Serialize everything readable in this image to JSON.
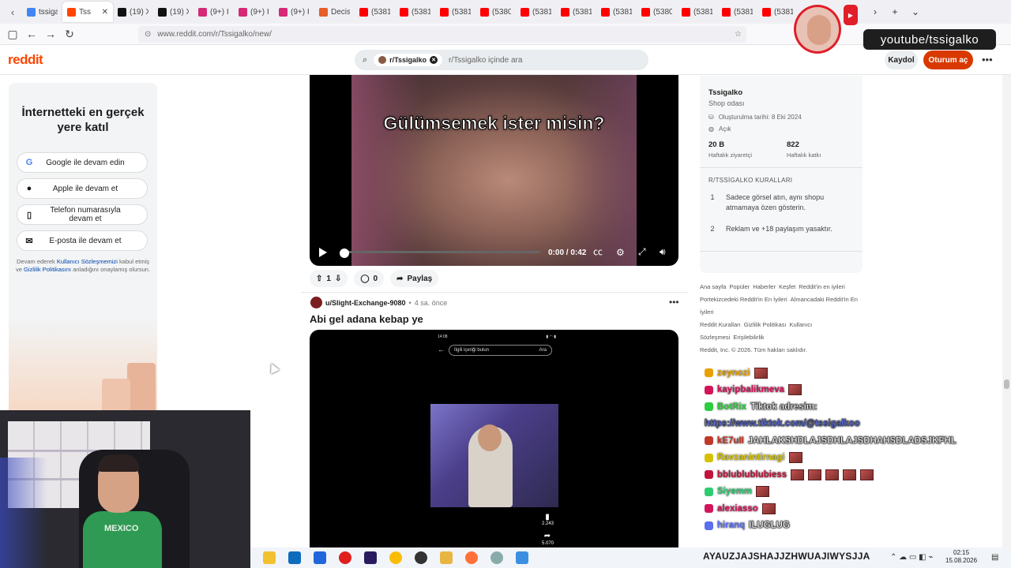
{
  "browser": {
    "tabs": [
      {
        "title": "tssiga",
        "color": "#4285f4"
      },
      {
        "title": "Tss",
        "color": "#ff4500",
        "active": true
      },
      {
        "title": "(19) X",
        "color": "#111111"
      },
      {
        "title": "(19) X",
        "color": "#111111"
      },
      {
        "title": "(9+) I",
        "color": "#d62976"
      },
      {
        "title": "(9+) I",
        "color": "#d62976"
      },
      {
        "title": "(9+) I",
        "color": "#d62976"
      },
      {
        "title": "Decisi",
        "color": "#e85d2a"
      },
      {
        "title": "(5381",
        "color": "#ff0000"
      },
      {
        "title": "(5381",
        "color": "#ff0000"
      },
      {
        "title": "(5381",
        "color": "#ff0000"
      },
      {
        "title": "(5380",
        "color": "#ff0000"
      },
      {
        "title": "(5381",
        "color": "#ff0000"
      },
      {
        "title": "(5381",
        "color": "#ff0000"
      },
      {
        "title": "(5381",
        "color": "#ff0000"
      },
      {
        "title": "(5380",
        "color": "#ff0000"
      },
      {
        "title": "(5381",
        "color": "#ff0000"
      },
      {
        "title": "(5381",
        "color": "#ff0000"
      },
      {
        "title": "(5381",
        "color": "#ff0000"
      }
    ],
    "url": "www.reddit.com/r/Tssigalko/new/"
  },
  "reddit": {
    "logo": "reddit",
    "search_chip": "r/Tssigalko",
    "search_placeholder": "r/Tssigalko içinde ara",
    "signup_label": "Kaydol",
    "login_label": "Oturum aç"
  },
  "join_card": {
    "title": "İnternetteki en gerçek yere katıl",
    "buttons": [
      {
        "icon": "G",
        "label": "Google ile devam edin"
      },
      {
        "icon": "",
        "label": "Apple ile devam et"
      },
      {
        "icon": "▯",
        "label": "Telefon numarasıyla devam et"
      },
      {
        "icon": "✉",
        "label": "E-posta ile devam et"
      }
    ],
    "legal_pre": "Devam ederek ",
    "legal_link1": "Kullanıcı Sözleşmemizi",
    "legal_mid": " kabul etmiş ve ",
    "legal_link2": "Gizlilik Politikasını",
    "legal_post": " anladığını onaylamış olursun."
  },
  "post1": {
    "overlay_text": "Gülümsemek ister misin?",
    "time": "0:00 / 0:42",
    "votes": "1",
    "comments": "0",
    "share": "Paylaş"
  },
  "post2": {
    "user": "u/Slight-Exchange-9080",
    "time": "4 sa. önce",
    "title": "Abi gel adana kebap ye",
    "phone_time": "14:08",
    "phone_search": "İlgili içeriği bulun",
    "phone_search_btn": "Ara",
    "likes": "2.243",
    "shares": "5.070"
  },
  "sidebar": {
    "name": "Tssigalko",
    "desc": "Shop odası",
    "created": "Oluşturulma tarihi: 8 Eki 2024",
    "visibility": "Açık",
    "stat1_value": "20 B",
    "stat1_label": "Haftalık ziyaretçi",
    "stat2_value": "822",
    "stat2_label": "Haftalık katkı",
    "rules_header": "R/TSSİGALKO KURALLARI",
    "rules": [
      {
        "n": "1",
        "text": "Sadece görsel atın, aynı shopu atmamaya özen gösterin."
      },
      {
        "n": "2",
        "text": "Reklam ve +18 paylaşım yasaktır."
      }
    ],
    "footer_links": [
      "Ana sayfa",
      "Popüler",
      "Haberler",
      "Keşfet",
      "Reddit'in en iyileri",
      "Portekizcedeki Reddit'in En İyileri",
      "Almancadaki Reddit'in En İyileri",
      "Reddit Kuralları",
      "Gizlilik Politikası",
      "Kullanıcı Sözleşmesi",
      "Erişilebilirlik",
      "Reddit, Inc. © 2026. Tüm hakları saklıdır."
    ]
  },
  "chat": [
    {
      "user": "zeynozi",
      "msg": "",
      "color": "#e8a200",
      "emotes": 1
    },
    {
      "user": "kayipbalikmeva",
      "msg": "",
      "color": "#d4145a",
      "emotes": 1
    },
    {
      "user": "BotRix",
      "msg": "Tiktok adresim:",
      "color": "#2ecc40",
      "emotes": 0
    },
    {
      "user": "",
      "msg": "https://www.tiktok.com/@tssigalkoo",
      "color": "#5a6ef0",
      "emotes": 0
    },
    {
      "user": "kE7uII",
      "msg": "JAHLAKSHDLAJSDHLAJSDHAHSDLADSJKFHL",
      "color": "#c0392b",
      "emotes": 0
    },
    {
      "user": "Ravzanintirnagi",
      "msg": "",
      "color": "#d4c200",
      "emotes": 1
    },
    {
      "user": "bblublublubiess",
      "msg": "",
      "color": "#c0143c",
      "emotes": 5
    },
    {
      "user": "Siyemm",
      "msg": "",
      "color": "#2ecc71",
      "emotes": 1
    },
    {
      "user": "alexiasso",
      "msg": "",
      "color": "#d4145a",
      "emotes": 1
    },
    {
      "user": "hiranq",
      "msg": "ILUGLUG",
      "color": "#5a6ef0",
      "emotes": 0
    }
  ],
  "overlay": {
    "channel": "youtube/tssigalko",
    "ticker": "AYAUZJAJSHAJJZHWUAJIWYSJJA"
  },
  "taskbar": {
    "time": "02:15",
    "date": "15.08.2026"
  }
}
